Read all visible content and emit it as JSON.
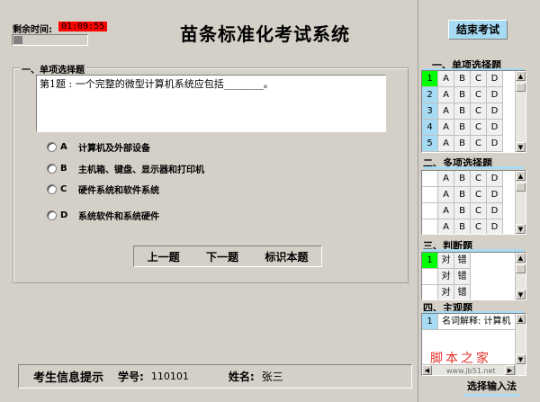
{
  "header": {
    "timer_label": "剩余时间:",
    "timer_value": "01:09:55",
    "timer_progress": 0.12,
    "title": "苗条标准化考试系统",
    "end_exam_label": "结束考试"
  },
  "question": {
    "group_title": "一、单项选择题",
    "text": "第1题 :  一个完整的微型计算机系统应包括________。",
    "options": [
      {
        "letter": "A",
        "text": "计算机及外部设备"
      },
      {
        "letter": "B",
        "text": "主机箱、键盘、显示器和打印机"
      },
      {
        "letter": "C",
        "text": "硬件系统和软件系统"
      },
      {
        "letter": "D",
        "text": "系统软件和系统硬件"
      }
    ],
    "nav": {
      "prev_label": "上一题",
      "next_label": "下一题",
      "mark_label": "标识本题"
    }
  },
  "student": {
    "title": "考生信息提示",
    "id_label": "学号:",
    "id_value": "110101",
    "name_label": "姓名:",
    "name_value": "张三"
  },
  "panel": {
    "single": {
      "title": "一、单项选择题",
      "rows": [
        {
          "num": "1",
          "opts": [
            "A",
            "B",
            "C",
            "D"
          ]
        },
        {
          "num": "2",
          "opts": [
            "A",
            "B",
            "C",
            "D"
          ]
        },
        {
          "num": "3",
          "opts": [
            "A",
            "B",
            "C",
            "D"
          ]
        },
        {
          "num": "4",
          "opts": [
            "A",
            "B",
            "C",
            "D"
          ]
        },
        {
          "num": "5",
          "opts": [
            "A",
            "B",
            "C",
            "D"
          ]
        }
      ]
    },
    "multi": {
      "title": "二、多项选择题",
      "rows": [
        {
          "num": "",
          "opts": [
            "A",
            "B",
            "C",
            "D"
          ]
        },
        {
          "num": "",
          "opts": [
            "A",
            "B",
            "C",
            "D"
          ]
        },
        {
          "num": "",
          "opts": [
            "A",
            "B",
            "C",
            "D"
          ]
        },
        {
          "num": "",
          "opts": [
            "A",
            "B",
            "C",
            "D"
          ]
        }
      ]
    },
    "judge": {
      "title": "三、判断题",
      "rows": [
        {
          "num": "1",
          "opts": [
            "对",
            "错"
          ]
        },
        {
          "num": "",
          "opts": [
            "对",
            "错"
          ]
        },
        {
          "num": "",
          "opts": [
            "对",
            "错"
          ]
        }
      ]
    },
    "subjective": {
      "title": "四、主观题",
      "rows": [
        {
          "num": "1",
          "text": "名词解释: 计算机"
        }
      ]
    },
    "ime_label": "选择输入法"
  },
  "watermark": {
    "cn": "脚本之家",
    "url": "www.jb51.net"
  },
  "colors": {
    "accent": "#a6dbf3",
    "active": "#00ff00",
    "timer_bg": "#ff0000",
    "window_bg": "#d4d0c8"
  }
}
